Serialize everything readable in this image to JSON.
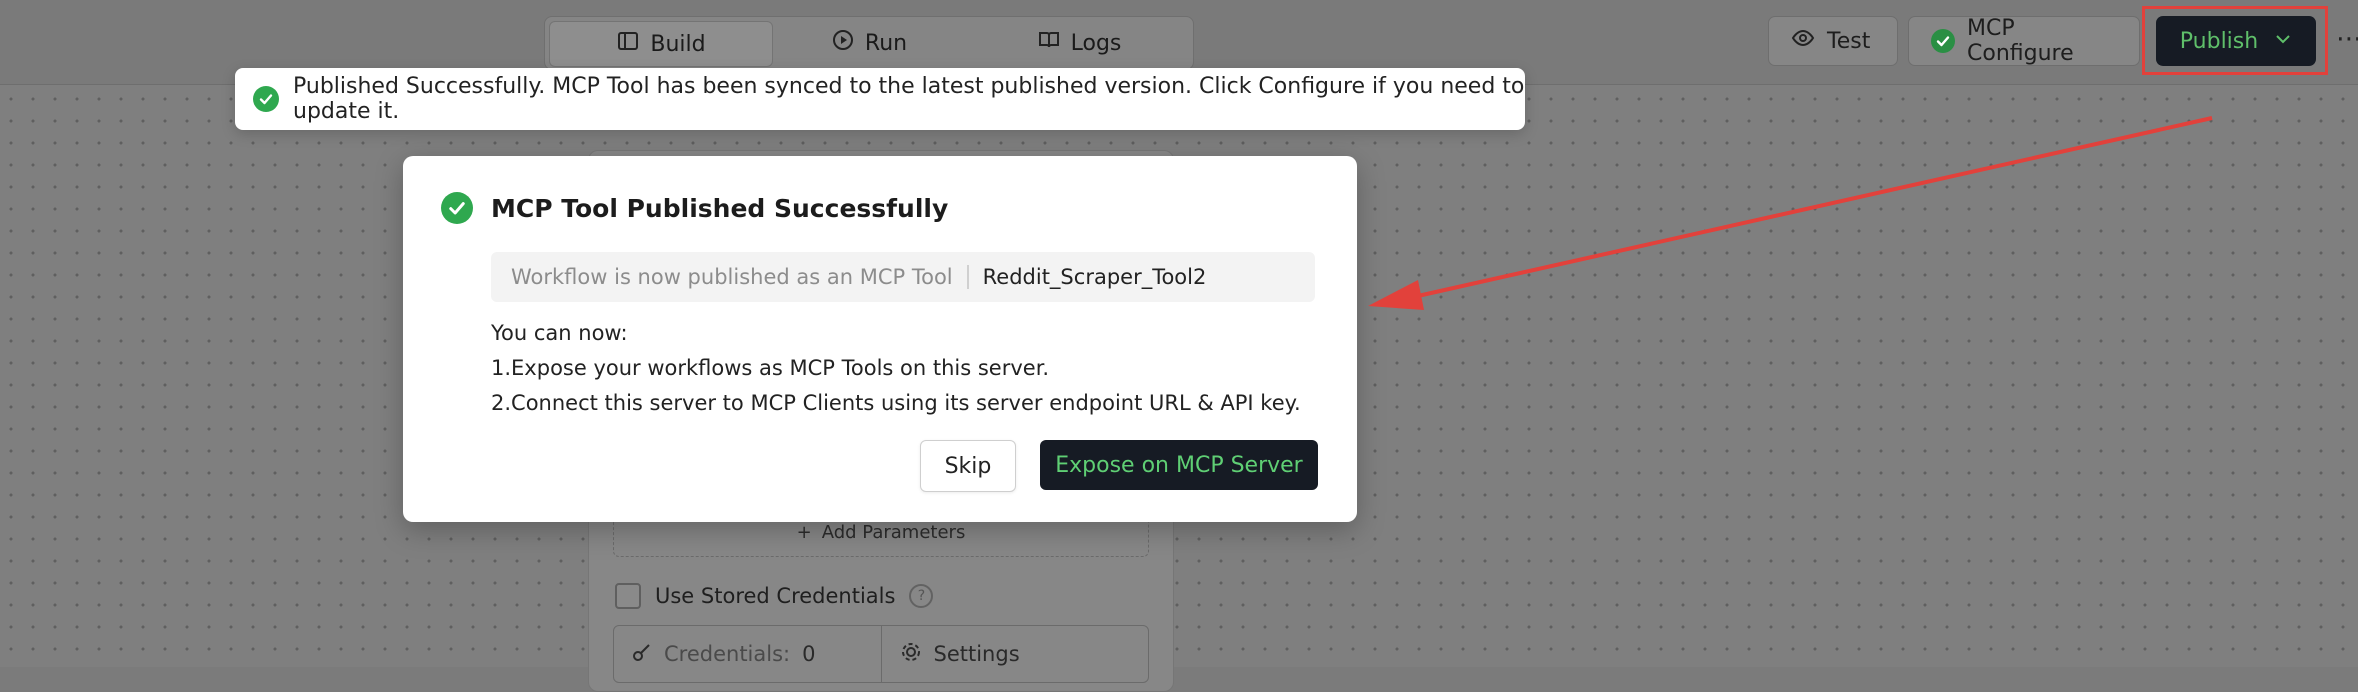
{
  "modes": [
    {
      "label": "Build",
      "icon": "build-icon",
      "active": true
    },
    {
      "label": "Run",
      "icon": "play-circle-icon",
      "active": false
    },
    {
      "label": "Logs",
      "icon": "book-icon",
      "active": false
    }
  ],
  "toolbar": {
    "test_label": "Test",
    "mcp_configure_label": "MCP Configure",
    "publish_label": "Publish"
  },
  "toast": {
    "message": "Published Successfully. MCP Tool has been synced to the latest published version. Click Configure if you need to update it."
  },
  "modal": {
    "title": "MCP Tool Published Successfully",
    "info_label": "Workflow is now published as an MCP Tool",
    "tool_name": "Reddit_Scraper_Tool2",
    "lines": [
      "You can now:",
      "1.Expose your workflows as MCP Tools on this server.",
      "2.Connect this server to MCP Clients using its server endpoint URL & API key."
    ],
    "skip_label": "Skip",
    "expose_label": "Expose on MCP Server"
  },
  "node": {
    "add_params_label": "Add Parameters",
    "use_stored_credentials_label": "Use Stored Credentials",
    "credentials_label": "Credentials:",
    "credentials_count": "0",
    "settings_label": "Settings"
  },
  "colors": {
    "success": "#2fa84f",
    "publish_bg": "#161b24",
    "publish_text": "#5fbf6a",
    "annotation": "#e2413b"
  }
}
